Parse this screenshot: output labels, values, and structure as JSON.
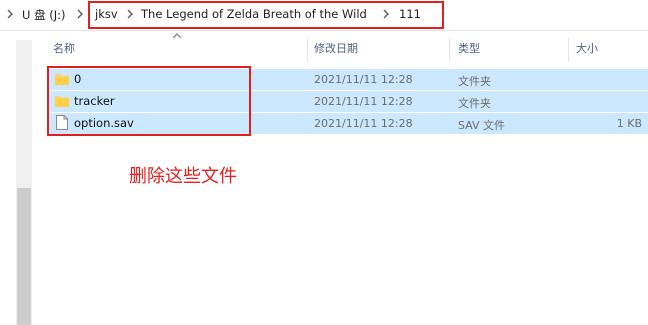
{
  "breadcrumb": {
    "items": [
      {
        "label": "U 盘 (J:)"
      },
      {
        "label": "jksv"
      },
      {
        "label": "The Legend of Zelda  Breath of the Wild"
      },
      {
        "label": "111"
      }
    ]
  },
  "columns": {
    "name": "名称",
    "date": "修改日期",
    "type": "类型",
    "size": "大小"
  },
  "files": [
    {
      "name": "0",
      "date": "2021/11/11 12:28",
      "type": "文件夹",
      "size": "",
      "icon": "folder-icon"
    },
    {
      "name": "tracker",
      "date": "2021/11/11 12:28",
      "type": "文件夹",
      "size": "",
      "icon": "folder-icon"
    },
    {
      "name": "option.sav",
      "date": "2021/11/11 12:28",
      "type": "SAV 文件",
      "size": "1 KB",
      "icon": "file-icon"
    }
  ],
  "annotation": {
    "text": "删除这些文件",
    "color": "#e0201e"
  },
  "colors": {
    "selection": "#cce8ff",
    "highlight_box": "#e0201e",
    "header_text": "#4d6185"
  }
}
